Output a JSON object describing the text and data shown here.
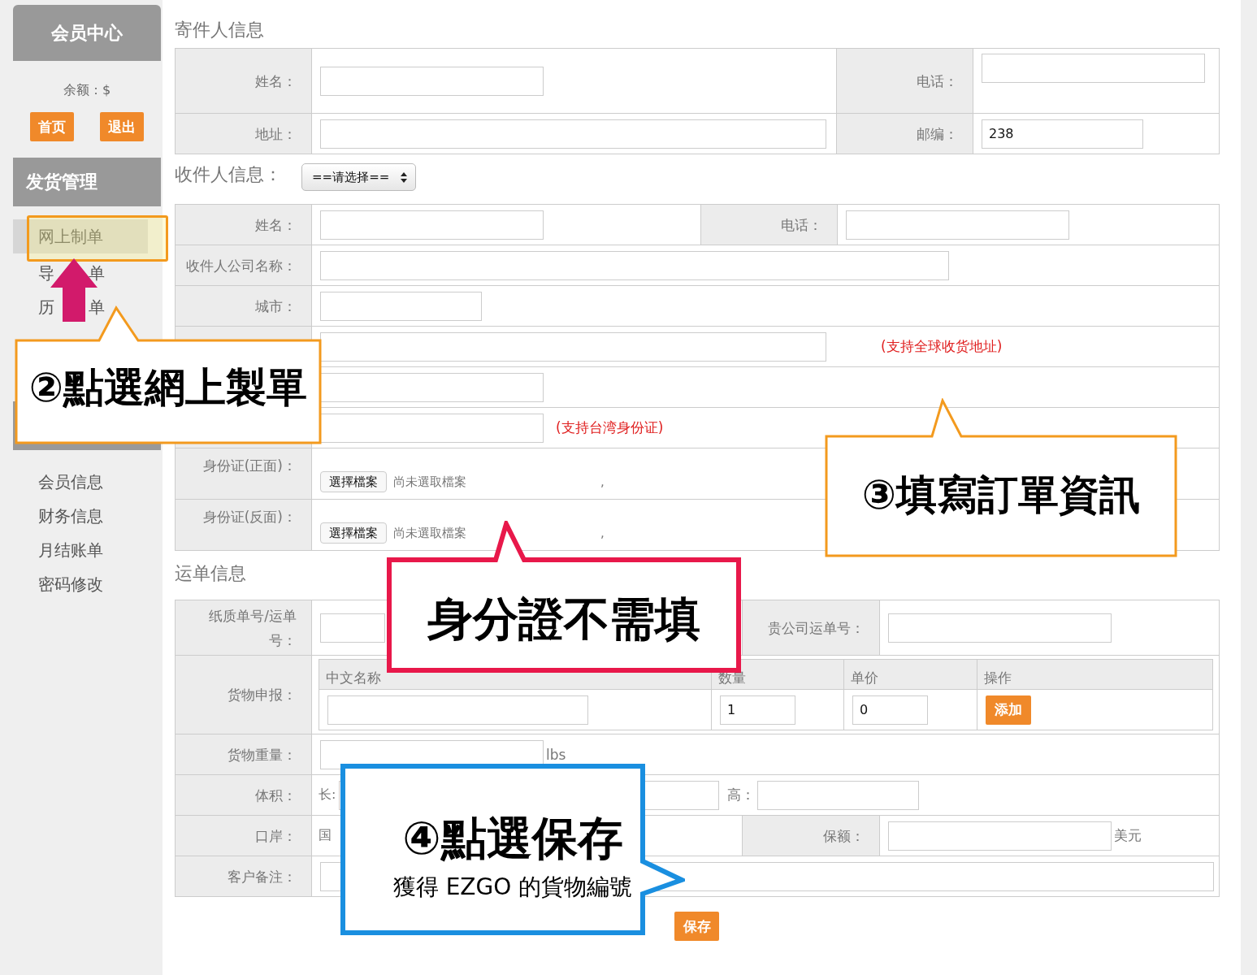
{
  "sidebar": {
    "header": "会员中心",
    "balance": "余额：$",
    "buttons": [
      "首页",
      "退出"
    ],
    "section_title": "发货管理",
    "menu": [
      {
        "label": "网上制单",
        "selected": true
      },
      {
        "label": "导",
        "label_end": "单",
        "selected": false
      },
      {
        "label": "历",
        "label_end": "单",
        "selected": false
      }
    ],
    "menu_2": [
      {
        "label": "会员信息",
        "selected": false
      },
      {
        "label": "财务信息",
        "selected": false
      },
      {
        "label": "月结账单",
        "selected": false
      },
      {
        "label": "密码修改",
        "selected": false
      }
    ]
  },
  "sender": {
    "title": "寄件人信息",
    "fields": [
      {
        "label": "姓名："
      },
      {
        "label": "电话："
      },
      {
        "label": "地址："
      },
      {
        "label": "邮编：",
        "value": "238"
      }
    ]
  },
  "receiver": {
    "title": "收件人信息：",
    "select": "==请选择==",
    "rows": [
      {
        "kind": "pair",
        "label": "姓名：",
        "second_label": "电话："
      },
      {
        "kind": "wide",
        "label": "收件人公司名称："
      },
      {
        "kind": "short",
        "label": "城市："
      },
      {
        "kind": "long",
        "note": "(支持全球收货地址)"
      },
      {
        "kind": "medium"
      },
      {
        "kind": "medium",
        "note": "(支持台湾身份证)"
      },
      {
        "kind": "file",
        "label": "身份证(正面)：",
        "button": "選擇檔案",
        "status": "尚未選取檔案",
        "mark": ","
      },
      {
        "kind": "file",
        "label": "身份证(反面)：",
        "button": "選擇檔案",
        "status": "尚未選取檔案",
        "mark": ","
      }
    ]
  },
  "waybill": {
    "title": "运单信息",
    "paper_label": "纸质单号/运单号：",
    "company_label": "贵公司运单号：",
    "goods": {
      "label": "货物申报：",
      "columns": [
        "中文名称",
        "数量",
        "单价",
        "操作"
      ],
      "quantity": "1",
      "price": "0",
      "button": "添加"
    },
    "weight": {
      "label": "货物重量：",
      "unit": "lbs"
    },
    "volume": {
      "label": "体积：",
      "length_label": "长:",
      "height_label": "高："
    },
    "port": {
      "label": "口岸：",
      "country_label": "国",
      "insurance_label": "保额：",
      "currency": "美元"
    },
    "remark": {
      "label": "客户备注："
    },
    "save": "保存"
  },
  "callouts": [
    {
      "title": "②點選網上製單",
      "color": "#f39a1e"
    },
    {
      "title": "③填寫訂單資訊",
      "color": "#f39a1e"
    },
    {
      "title": "身分證不需填",
      "color": "#e8184a"
    },
    {
      "title": "④點選保存",
      "subtitle": "獲得 EZGO 的貨物編號",
      "color": "#1a8fe0"
    }
  ]
}
